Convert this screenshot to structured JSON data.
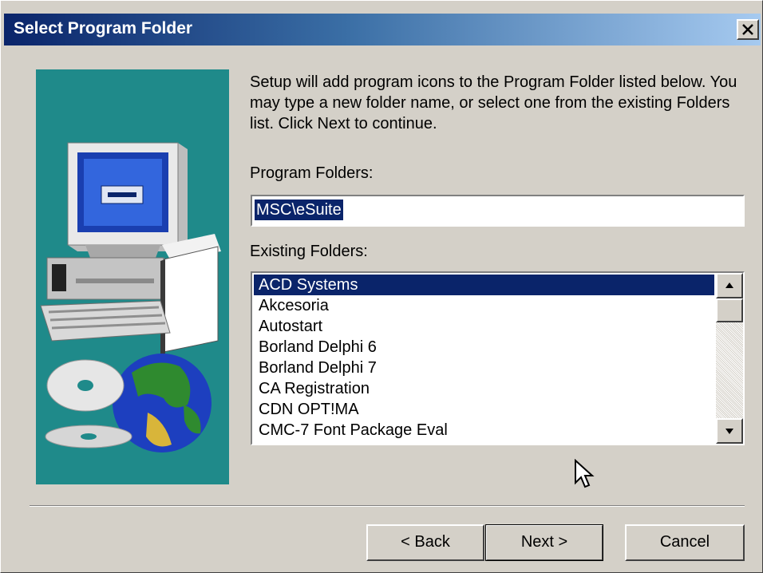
{
  "window": {
    "title": "Select Program Folder",
    "close_icon": "close-icon"
  },
  "description": "Setup will add program icons to the Program Folder listed below. You may type a new folder name, or select one from the existing Folders list.  Click Next to continue.",
  "program_folders": {
    "label": "Program Folders:",
    "value": "MSC\\eSuite"
  },
  "existing_folders": {
    "label": "Existing Folders:",
    "items": [
      "ACD Systems",
      "Akcesoria",
      "Autostart",
      "Borland Delphi 6",
      "Borland Delphi 7",
      "CA Registration",
      "CDN OPT!MA",
      "CMC-7 Font Package Eval"
    ],
    "selected_index": 0
  },
  "buttons": {
    "back": "< Back",
    "next": "Next >",
    "cancel": "Cancel"
  },
  "colors": {
    "titlebar_start": "#0a246a",
    "titlebar_end": "#a6caf0",
    "selection": "#0a246a",
    "illustration_bg": "#1f8a8a",
    "dialog_bg": "#d4d0c8"
  }
}
